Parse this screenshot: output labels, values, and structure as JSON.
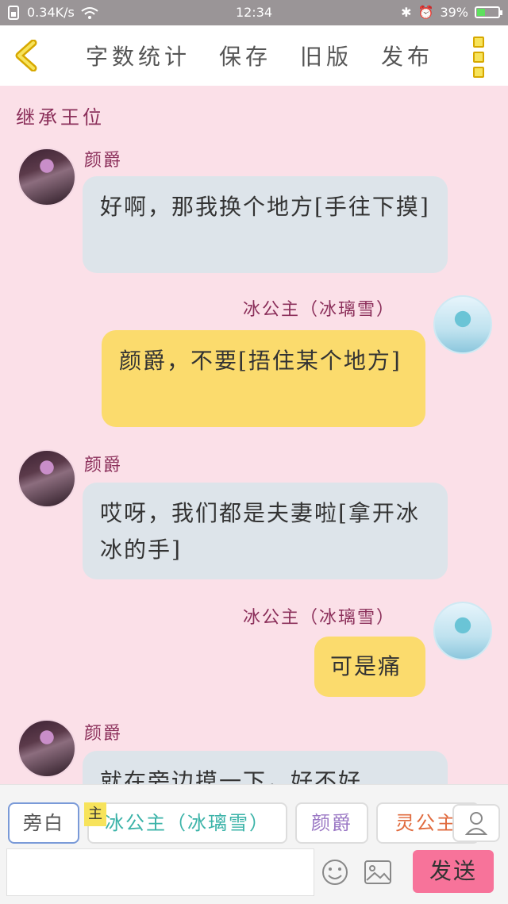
{
  "status_bar": {
    "speed": "0.34K/s",
    "time": "12:34",
    "battery": "39%",
    "battery_level": 0.39
  },
  "header": {
    "actions": [
      "字数统计",
      "保存",
      "旧版",
      "发布"
    ]
  },
  "chapter_title": "继承王位",
  "messages": [
    {
      "side": "left",
      "name": "颜爵",
      "text": "好啊，那我换个地方[手往下摸]"
    },
    {
      "side": "right",
      "name": "冰公主（冰璃雪）",
      "text": "颜爵，不要[捂住某个地方]"
    },
    {
      "side": "left",
      "name": "颜爵",
      "text": "哎呀，我们都是夫妻啦[拿开冰冰的手]"
    },
    {
      "side": "right",
      "name": "冰公主（冰璃雪）",
      "text": "可是痛"
    },
    {
      "side": "left",
      "name": "颜爵",
      "text": "就在旁边摸一下，好不好"
    }
  ],
  "bottom": {
    "roles": [
      "旁白",
      "冰公主（冰璃雪）",
      "颜爵",
      "灵公主"
    ],
    "role_colors": [
      "#555555",
      "#3bb3a8",
      "#9a77c4",
      "#e06a3d"
    ],
    "main_tag": "主",
    "send_label": "发送",
    "input_placeholder": ""
  }
}
